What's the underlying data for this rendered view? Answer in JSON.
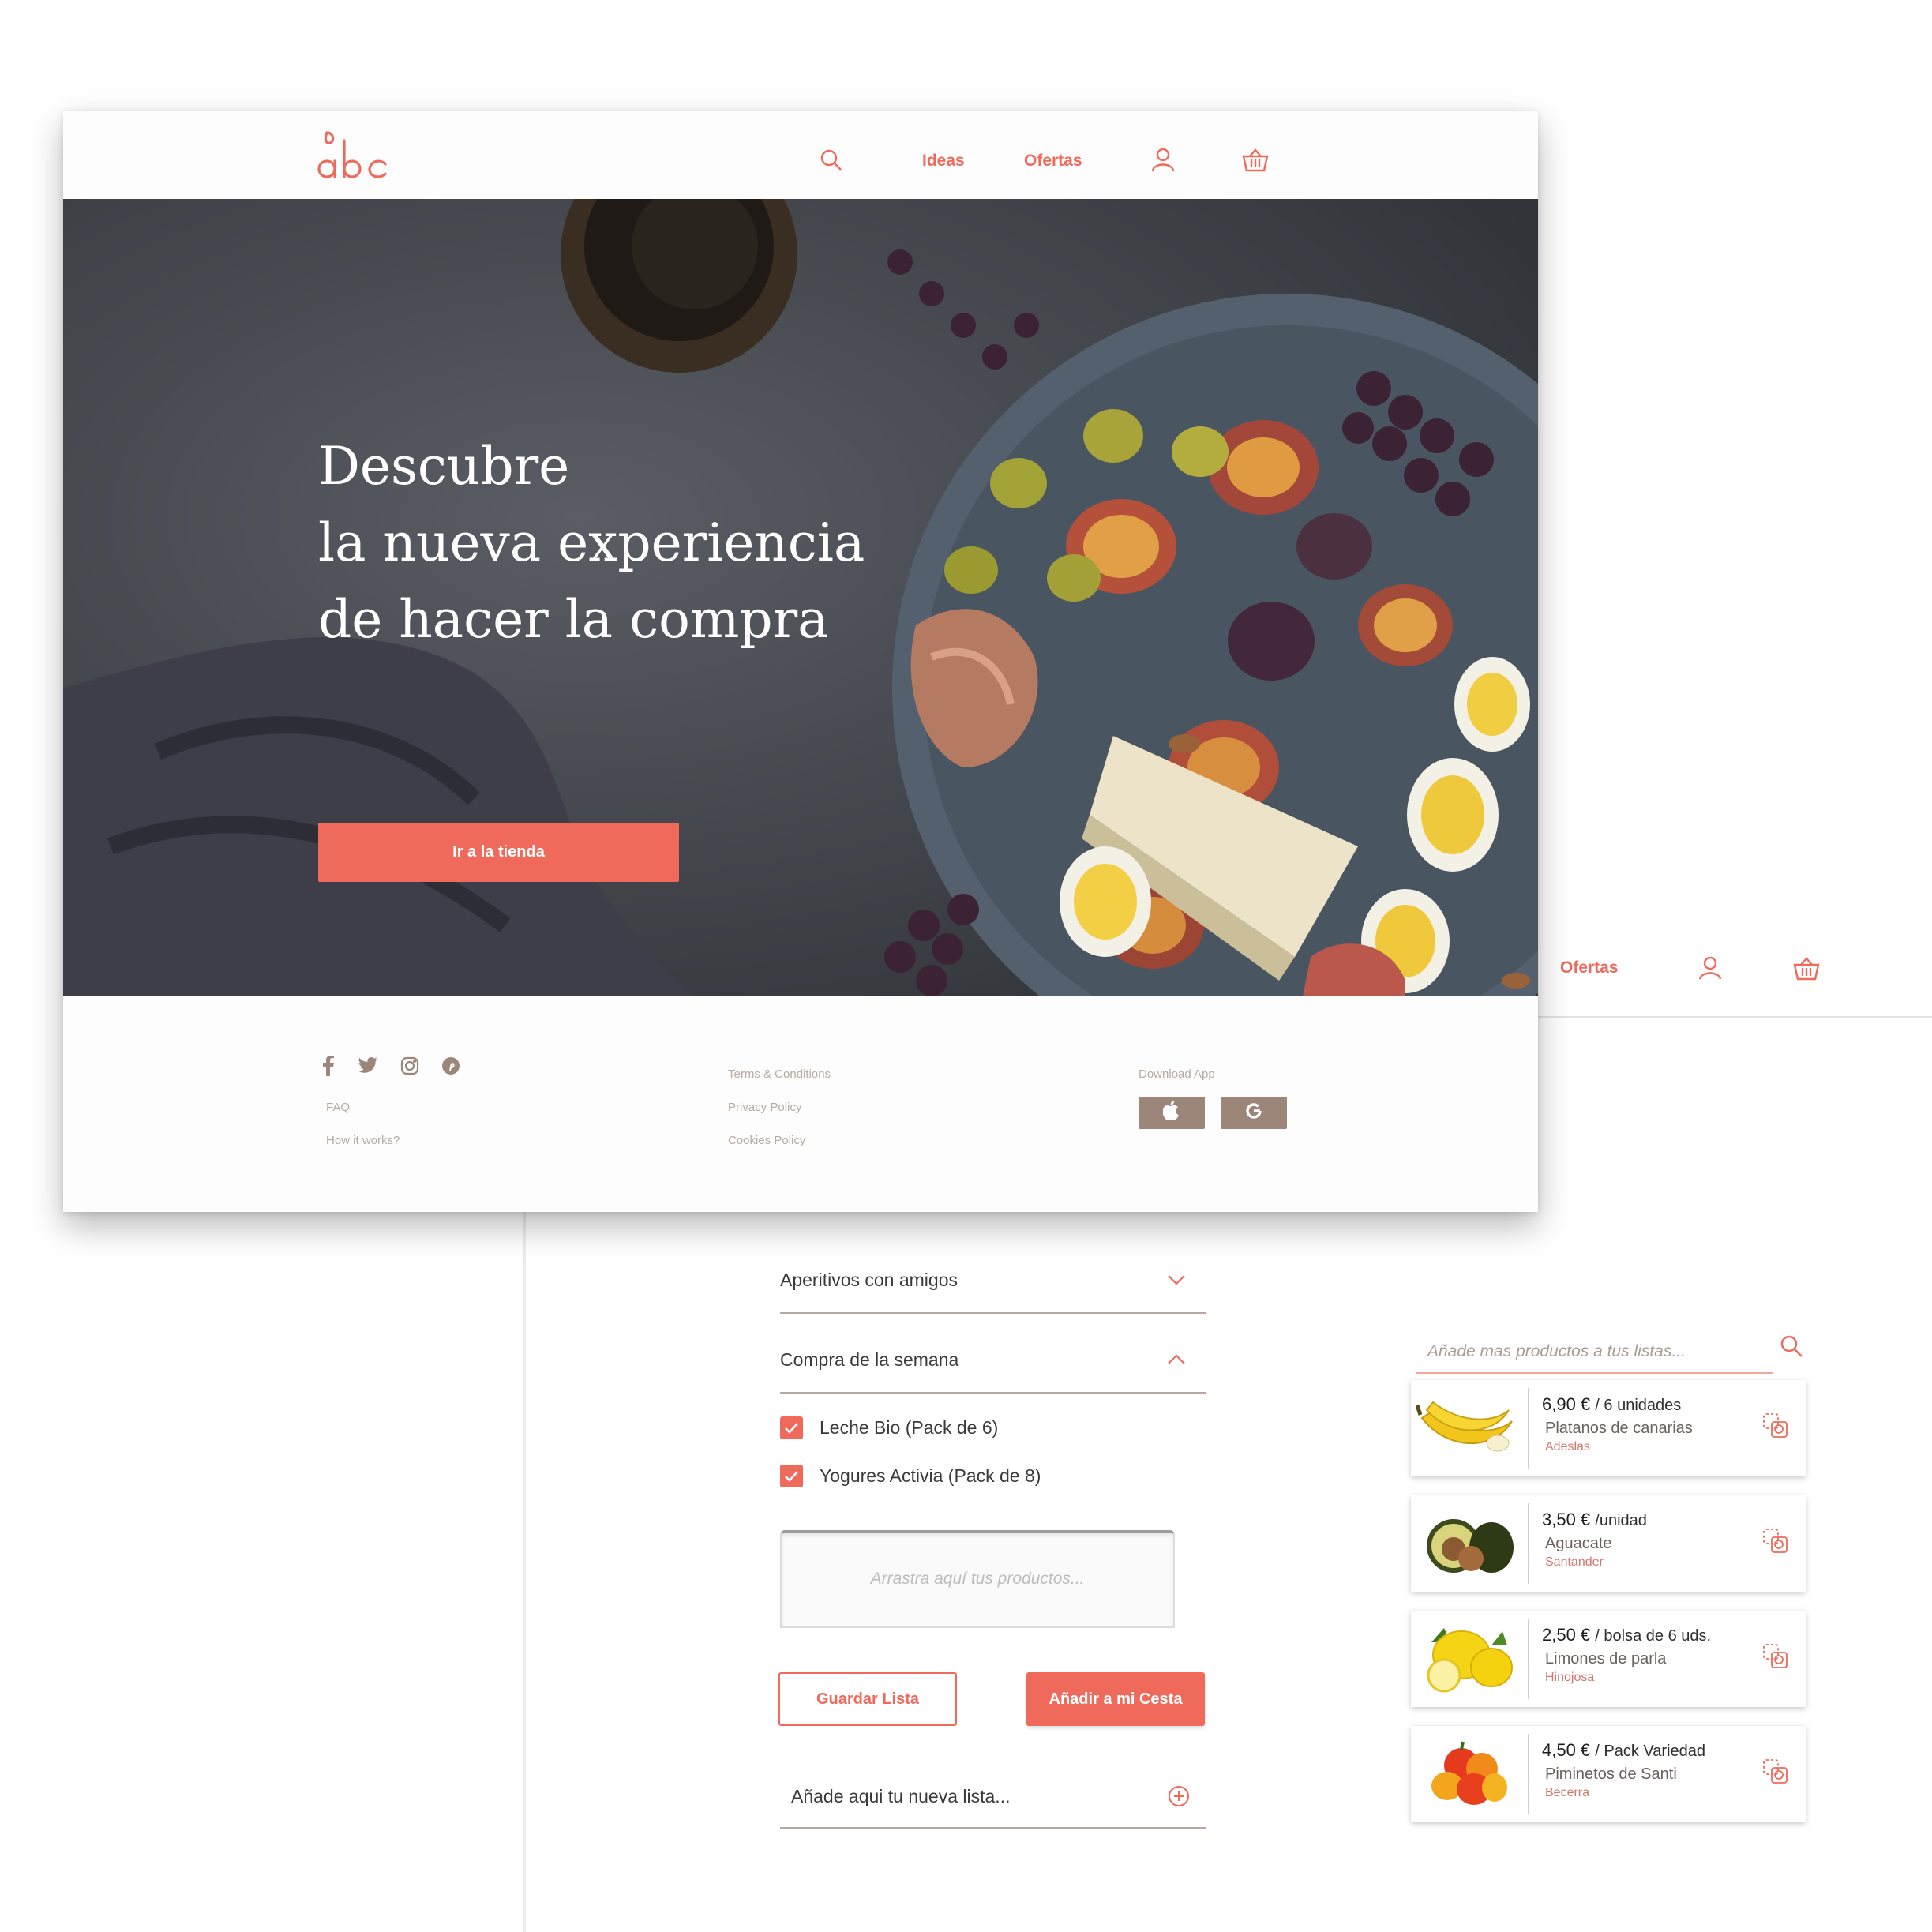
{
  "colors": {
    "accent": "#f06a5c",
    "footer_brown": "#9c8679",
    "text_dark": "#3b3a3a"
  },
  "brand": {
    "logo_text": "abc"
  },
  "front_header": {
    "nav": {
      "ideas": "Ideas",
      "offers": "Ofertas"
    },
    "icons": [
      "search-icon",
      "user-icon",
      "basket-icon"
    ]
  },
  "hero": {
    "title_lines": [
      "Descubre",
      "la nueva experiencia",
      "de hacer la compra"
    ],
    "button_label": "Ir a la tienda"
  },
  "footer": {
    "social_icons": [
      "facebook-icon",
      "twitter-icon",
      "instagram-icon",
      "pinterest-icon"
    ],
    "links_left": [
      "FAQ",
      "How it works?"
    ],
    "links_middle": [
      "Terms & Conditions",
      "Privacy Policy",
      "Cookies Policy"
    ],
    "download_label": "Download App",
    "app_icons": [
      "apple-icon",
      "google-icon"
    ]
  },
  "back_header": {
    "nav": {
      "offers": "Ofertas"
    },
    "icons": [
      "user-icon",
      "basket-icon"
    ]
  },
  "lists": {
    "accordion": [
      {
        "label": "Aperitivos con amigos",
        "expanded": false
      },
      {
        "label": "Compra de la semana",
        "expanded": true
      }
    ],
    "items": [
      {
        "label": "Leche Bio (Pack de 6)",
        "checked": true
      },
      {
        "label": "Yogures Activia (Pack de 8)",
        "checked": true
      }
    ],
    "drop_placeholder": "Arrastra aquí tus productos...",
    "save_button": "Guardar Lista",
    "add_cart_button": "Añadir a mi Cesta",
    "new_list_placeholder": "Añade aqui tu nueva lista..."
  },
  "products": {
    "search_placeholder": "Añade mas productos a tus listas...",
    "items": [
      {
        "price": "6,90 €",
        "unit": "/ 6 unidades",
        "name": "Platanos de canarias",
        "origin": "Adeslas",
        "icon": "banana-icon"
      },
      {
        "price": "3,50 €",
        "unit": "/unidad",
        "name": "Aguacate",
        "origin": "Santander",
        "icon": "avocado-icon"
      },
      {
        "price": "2,50 €",
        "unit": "/ bolsa de 6 uds.",
        "name": "Limones de parla",
        "origin": "Hinojosa",
        "icon": "lemon-icon"
      },
      {
        "price": "4,50 €",
        "unit": "/ Pack Variedad",
        "name": "Piminetos de Santi",
        "origin": "Becerra",
        "icon": "pepper-icon"
      }
    ]
  }
}
